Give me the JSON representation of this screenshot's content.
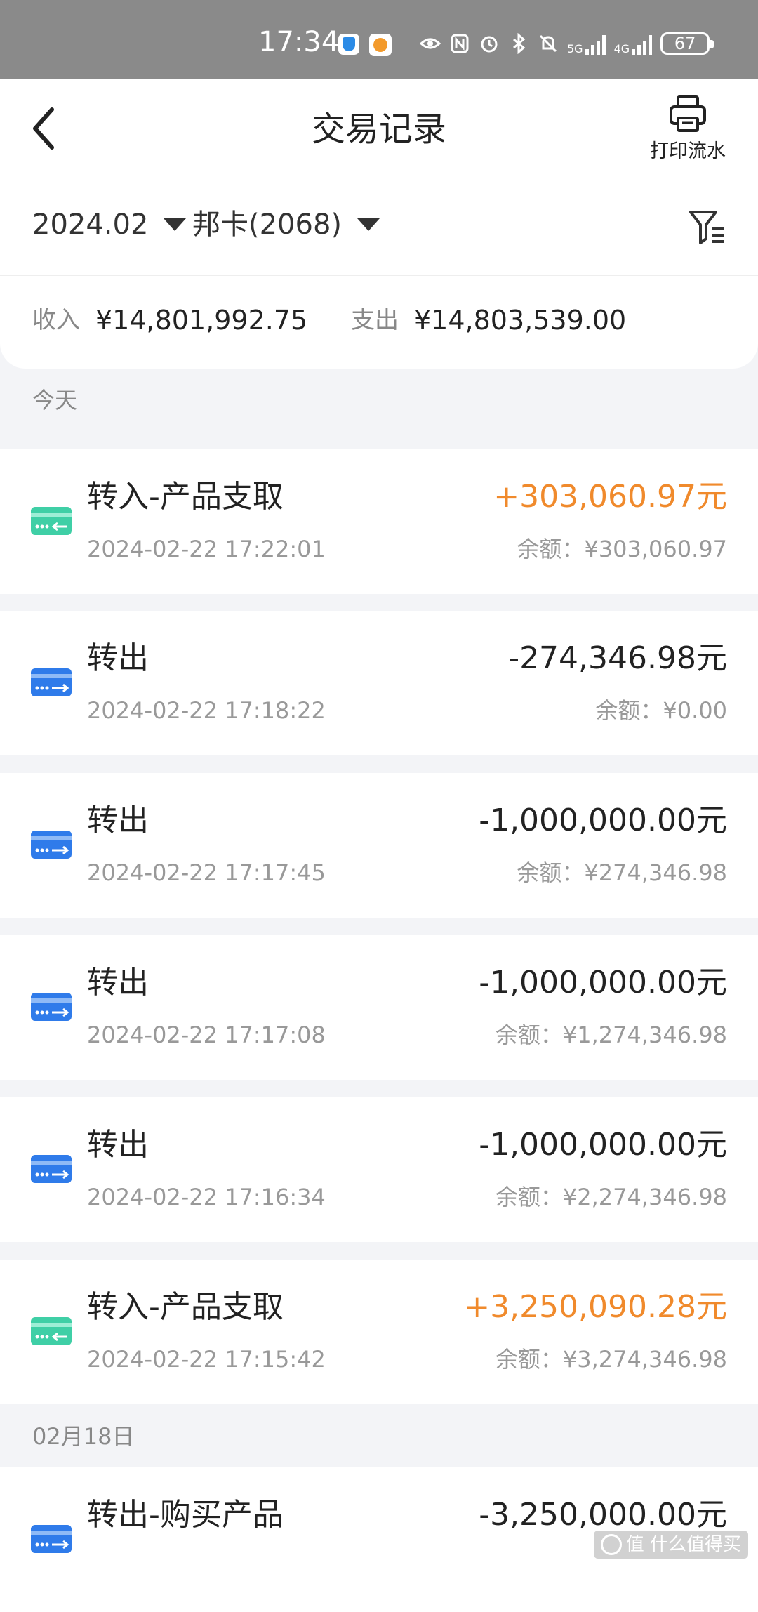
{
  "status_bar": {
    "time": "17:34",
    "network_1": "5G",
    "network_2": "4G",
    "battery": "67",
    "icons": [
      "shield-app-icon",
      "orange-app-icon",
      "eye-icon",
      "nfc-icon",
      "alarm-icon",
      "bluetooth-icon",
      "mute-icon",
      "signal-icon",
      "battery-icon"
    ]
  },
  "header": {
    "title": "交易记录",
    "print_label": "打印流水"
  },
  "filters": {
    "month": "2024.02",
    "card": "邦卡(2068)"
  },
  "summary": {
    "income_label": "收入",
    "income_value": "¥14,801,992.75",
    "expense_label": "支出",
    "expense_value": "¥14,803,539.00"
  },
  "sections": [
    {
      "label": "今天",
      "transactions": [
        {
          "name": "转入-产品支取",
          "time": "2024-02-22 17:22:01",
          "amount": "+303,060.97元",
          "balance": "余额：¥303,060.97",
          "direction": "in"
        },
        {
          "name": "转出",
          "time": "2024-02-22 17:18:22",
          "amount": "-274,346.98元",
          "balance": "余额：¥0.00",
          "direction": "out"
        },
        {
          "name": "转出",
          "time": "2024-02-22 17:17:45",
          "amount": "-1,000,000.00元",
          "balance": "余额：¥274,346.98",
          "direction": "out"
        },
        {
          "name": "转出",
          "time": "2024-02-22 17:17:08",
          "amount": "-1,000,000.00元",
          "balance": "余额：¥1,274,346.98",
          "direction": "out"
        },
        {
          "name": "转出",
          "time": "2024-02-22 17:16:34",
          "amount": "-1,000,000.00元",
          "balance": "余额：¥2,274,346.98",
          "direction": "out"
        },
        {
          "name": "转入-产品支取",
          "time": "2024-02-22 17:15:42",
          "amount": "+3,250,090.28元",
          "balance": "余额：¥3,274,346.98",
          "direction": "in"
        }
      ]
    },
    {
      "label": "02月18日",
      "transactions": [
        {
          "name": "转出-购买产品",
          "time": "",
          "amount": "-3,250,000.00元",
          "balance": "",
          "direction": "out"
        }
      ]
    }
  ],
  "colors": {
    "income_amount": "#f08a2c",
    "in_icon": "#3fcfa6",
    "out_icon": "#2f7bea"
  },
  "watermark": "值 什么值得买"
}
